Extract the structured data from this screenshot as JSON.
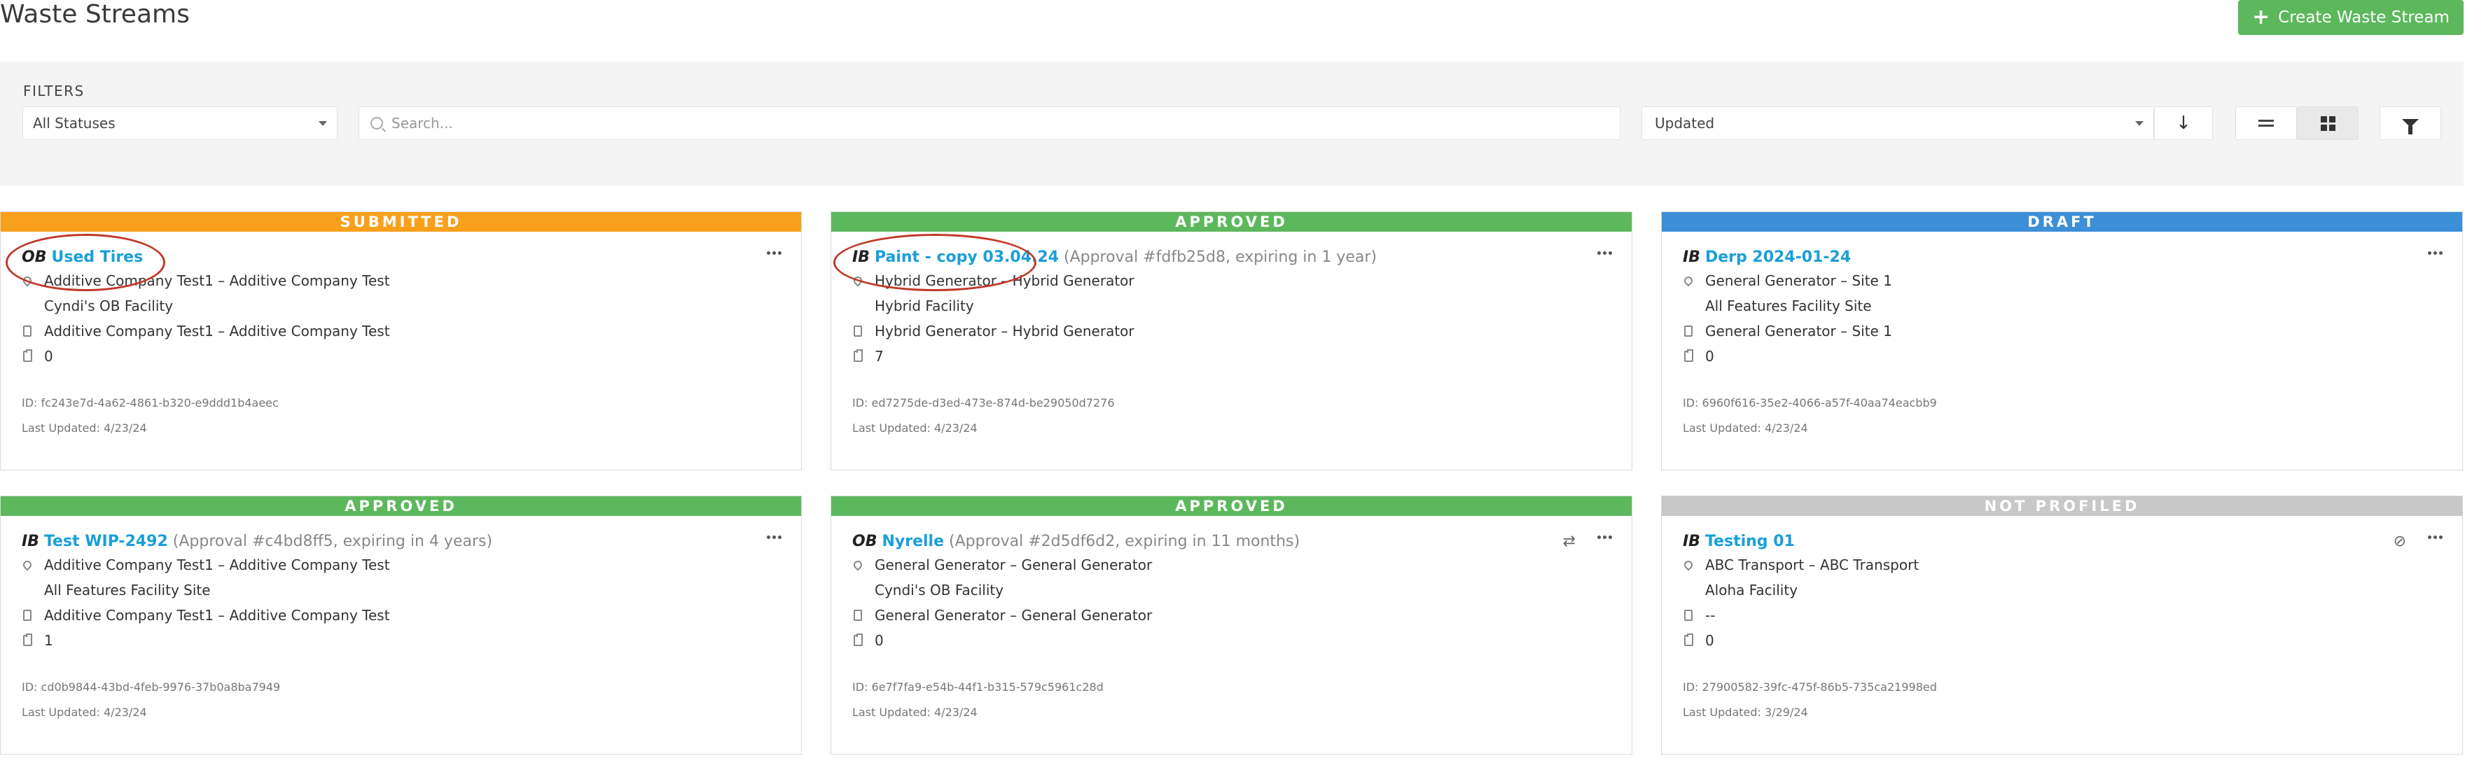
{
  "page": {
    "title": "Waste Streams",
    "create_button": "Create Waste Stream"
  },
  "filters": {
    "label": "FILTERS",
    "status_value": "All Statuses",
    "search_placeholder": "Search...",
    "sort_value": "Updated",
    "sort_direction_icon": "↓"
  },
  "colors": {
    "submitted": "#f8a01c",
    "approved": "#5cb85c",
    "draft": "#3d8fd8",
    "not_profiled": "#c8c8c8",
    "link": "#1a9fd9",
    "accent_button": "#5cb85c"
  },
  "cards": [
    {
      "status": "SUBMITTED",
      "direction": "OB",
      "name": "Used Tires",
      "approval": "",
      "generator": "Additive Company Test1 – Additive Company Test",
      "facility": "Cyndi's OB Facility",
      "profile": "Additive Company Test1 – Additive Company Test",
      "count": "0",
      "id": "ID: fc243e7d-4a62-4861-b320-e9ddd1b4aeec",
      "updated": "Last Updated: 4/23/24"
    },
    {
      "status": "APPROVED",
      "direction": "IB",
      "name": "Paint - copy 03.04.24",
      "approval": "(Approval #fdfb25d8, expiring in 1 year)",
      "generator": "Hybrid Generator – Hybrid Generator",
      "facility": "Hybrid Facility",
      "profile": "Hybrid Generator – Hybrid Generator",
      "count": "7",
      "id": "ID: ed7275de-d3ed-473e-874d-be29050d7276",
      "updated": "Last Updated: 4/23/24"
    },
    {
      "status": "DRAFT",
      "direction": "IB",
      "name": "Derp 2024-01-24",
      "approval": "",
      "generator": "General Generator – Site 1",
      "facility": "All Features Facility Site",
      "profile": "General Generator – Site 1",
      "count": "0",
      "id": "ID: 6960f616-35e2-4066-a57f-40aa74eacbb9",
      "updated": "Last Updated: 4/23/24"
    },
    {
      "status": "APPROVED",
      "direction": "IB",
      "name": "Test WIP-2492",
      "approval": "(Approval #c4bd8ff5, expiring in 4 years)",
      "generator": "Additive Company Test1 – Additive Company Test",
      "facility": "All Features Facility Site",
      "profile": "Additive Company Test1 – Additive Company Test",
      "count": "1",
      "id": "ID: cd0b9844-43bd-4feb-9976-37b0a8ba7949",
      "updated": "Last Updated: 4/23/24"
    },
    {
      "status": "APPROVED",
      "direction": "OB",
      "name": "Nyrelle",
      "approval": "(Approval #2d5df6d2, expiring in 11 months)",
      "generator": "General Generator – General Generator",
      "facility": "Cyndi's OB Facility",
      "profile": "General Generator – General Generator",
      "count": "0",
      "id": "ID: 6e7f7fa9-e54b-44f1-b315-579c5961c28d",
      "updated": "Last Updated: 4/23/24"
    },
    {
      "status": "NOT PROFILED",
      "direction": "IB",
      "name": "Testing 01",
      "approval": "",
      "generator": "ABC Transport – ABC Transport",
      "facility": "Aloha Facility",
      "profile": "--",
      "count": "0",
      "id": "ID: 27900582-39fc-475f-86b5-735ca21998ed",
      "updated": "Last Updated: 3/29/24"
    }
  ]
}
